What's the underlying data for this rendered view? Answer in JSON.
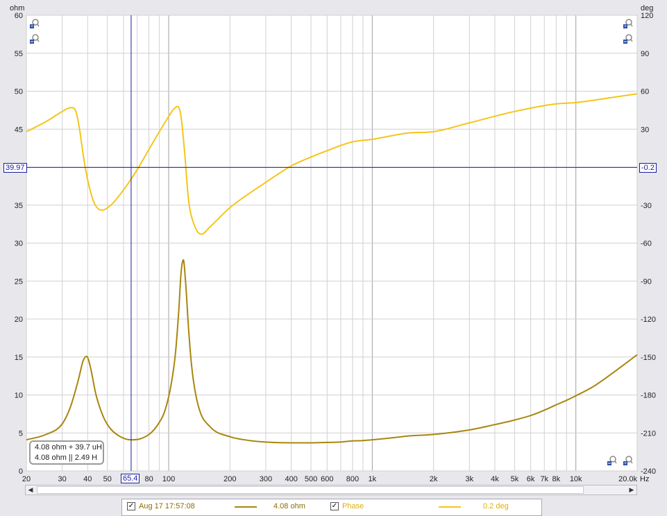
{
  "chart_data": {
    "type": "line",
    "x_scale": "log",
    "xlim": [
      20,
      20000
    ],
    "x_unit": "Hz",
    "x_ticks": [
      {
        "v": 20,
        "label": "20"
      },
      {
        "v": 30,
        "label": "30"
      },
      {
        "v": 40,
        "label": "40"
      },
      {
        "v": 50,
        "label": "50"
      },
      {
        "v": 80,
        "label": "80"
      },
      {
        "v": 100,
        "label": "100"
      },
      {
        "v": 200,
        "label": "200"
      },
      {
        "v": 300,
        "label": "300"
      },
      {
        "v": 400,
        "label": "400"
      },
      {
        "v": 500,
        "label": "500"
      },
      {
        "v": 600,
        "label": "600"
      },
      {
        "v": 800,
        "label": "800"
      },
      {
        "v": 1000,
        "label": "1k"
      },
      {
        "v": 2000,
        "label": "2k"
      },
      {
        "v": 3000,
        "label": "3k"
      },
      {
        "v": 4000,
        "label": "4k"
      },
      {
        "v": 5000,
        "label": "5k"
      },
      {
        "v": 6000,
        "label": "6k"
      },
      {
        "v": 7000,
        "label": "7k"
      },
      {
        "v": 8000,
        "label": "8k"
      },
      {
        "v": 10000,
        "label": "10k"
      },
      {
        "v": 20000,
        "label": "20.0k"
      }
    ],
    "grid": true,
    "left_axis": {
      "unit": "ohm",
      "ylim": [
        0,
        60
      ],
      "ticks": [
        0,
        5,
        10,
        15,
        20,
        25,
        30,
        35,
        40,
        45,
        50,
        55,
        60
      ]
    },
    "right_axis": {
      "unit": "deg",
      "ylim": [
        -240,
        120
      ],
      "ticks": [
        -240,
        -210,
        -180,
        -150,
        -120,
        -90,
        -60,
        -30,
        0,
        30,
        60,
        90,
        120
      ]
    },
    "cursor": {
      "x_label": "65.4",
      "left_label": "39.97",
      "right_label": "-0.2"
    },
    "readout": [
      "4.08 ohm + 39.7 uH",
      "4.08 ohm || 2.49 H"
    ],
    "series": [
      {
        "name": "Aug 17 17:57:08",
        "axis": "left",
        "color": "#a8860c",
        "x": [
          20,
          25,
          30,
          33,
          36,
          38,
          39.5,
          41,
          44,
          48,
          52,
          58,
          65,
          72,
          80,
          88,
          96,
          103,
          108,
          112,
          115,
          118,
          121,
          125,
          130,
          140,
          160,
          200,
          250,
          300,
          400,
          500,
          600,
          700,
          800,
          900,
          1000,
          1200,
          1500,
          2000,
          3000,
          4000,
          5000,
          6000,
          7000,
          8000,
          9000,
          10000,
          12000,
          15000,
          20000
        ],
        "values": [
          4.1,
          4.8,
          6.2,
          8.5,
          12.0,
          14.5,
          15.1,
          14.0,
          10.0,
          7.0,
          5.5,
          4.5,
          4.1,
          4.2,
          4.8,
          6.0,
          8.0,
          11.5,
          15.5,
          21.0,
          26.0,
          27.8,
          25.0,
          19.0,
          13.5,
          8.5,
          5.8,
          4.5,
          4.0,
          3.8,
          3.7,
          3.7,
          3.75,
          3.8,
          3.95,
          4.0,
          4.1,
          4.3,
          4.6,
          4.8,
          5.4,
          6.1,
          6.7,
          7.3,
          8.0,
          8.7,
          9.3,
          9.9,
          11.0,
          12.8,
          15.3
        ]
      },
      {
        "name": "Phase",
        "axis": "right",
        "color": "#f5c518",
        "x": [
          20,
          25,
          30,
          33,
          35,
          36.5,
          38,
          40,
          43,
          47,
          52,
          60,
          70,
          80,
          90,
          100,
          106,
          111,
          115,
          120,
          125,
          133,
          145,
          160,
          200,
          300,
          400,
          500,
          600,
          800,
          1000,
          1500,
          2000,
          3000,
          5000,
          8000,
          10000,
          15000,
          20000
        ],
        "values": [
          28,
          36,
          44,
          47,
          44,
          30,
          10,
          -10,
          -28,
          -34,
          -30,
          -18,
          -2,
          14,
          28,
          40,
          46,
          48,
          40,
          10,
          -25,
          -45,
          -53,
          -47,
          -32,
          -12,
          1,
          8,
          13,
          20,
          22,
          27,
          28,
          35,
          44,
          50,
          51,
          55,
          58
        ]
      }
    ]
  },
  "legend_bar": {
    "measurement_name": "Aug 17 17:57:08",
    "measurement_value": "4.08 ohm",
    "phase_name": "Phase",
    "phase_value": "0.2 deg",
    "check_mark": "✓"
  },
  "colors": {
    "impedance": "#a8860c",
    "phase": "#f5c518",
    "cursor": "#1a1aa0"
  }
}
